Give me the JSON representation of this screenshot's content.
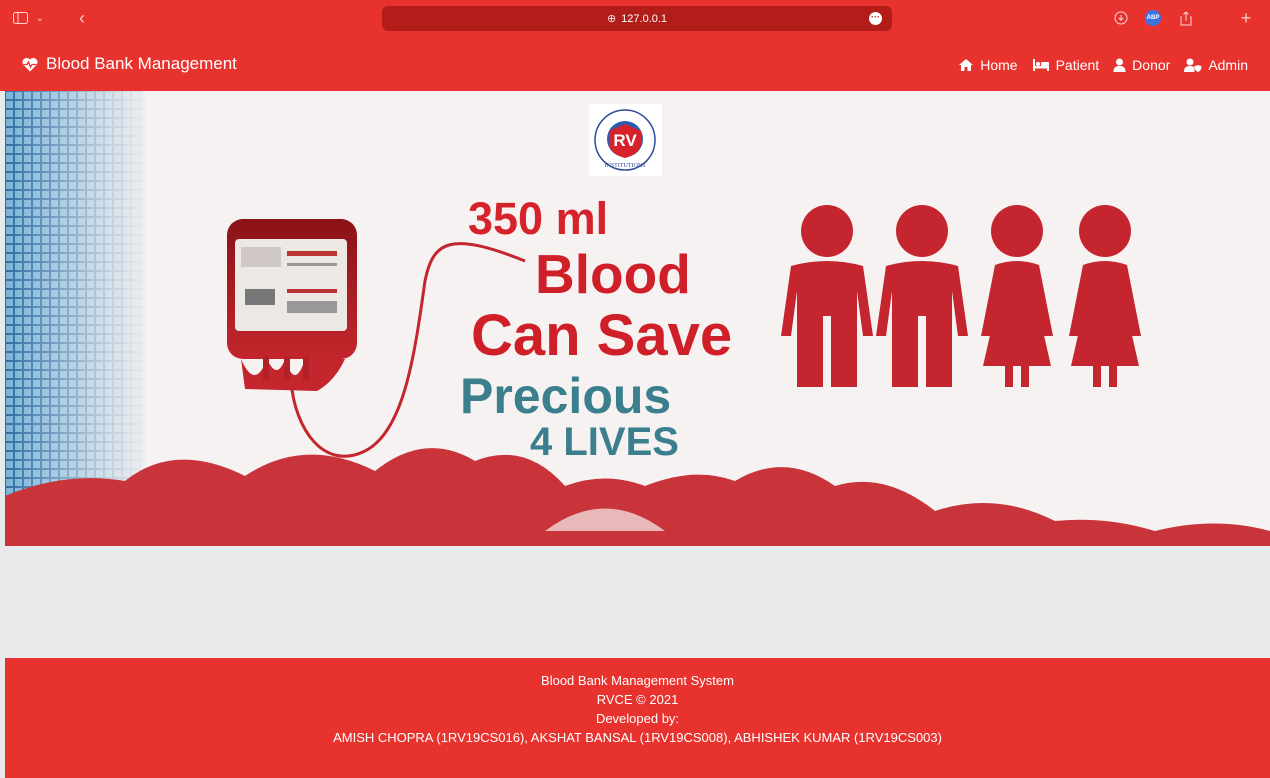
{
  "browser": {
    "url": "127.0.0.1",
    "extension_badge": "ABP"
  },
  "navbar": {
    "brand": "Blood Bank Management",
    "links": [
      {
        "label": "Home",
        "icon": "home-icon"
      },
      {
        "label": "Patient",
        "icon": "bed-icon"
      },
      {
        "label": "Donor",
        "icon": "user-icon"
      },
      {
        "label": "Admin",
        "icon": "user-shield-icon"
      }
    ]
  },
  "banner": {
    "logo_text": "RV",
    "logo_caption": "INSTITUTIONS",
    "line1": "350 ml",
    "line2": "Blood",
    "line3": "Can Save",
    "line4": "Precious",
    "line5": "4 LIVES"
  },
  "footer": {
    "line1": "Blood Bank Management System",
    "line2": "RVCE © 2021",
    "line3": "Developed by:",
    "line4": "AMISH CHOPRA (1RV19CS016), AKSHAT BANSAL (1RV19CS008), ABHISHEK KUMAR (1RV19CS003)"
  },
  "colors": {
    "primary": "#e8322d",
    "blood": "#c4252e",
    "teal": "#3b7f8e"
  }
}
